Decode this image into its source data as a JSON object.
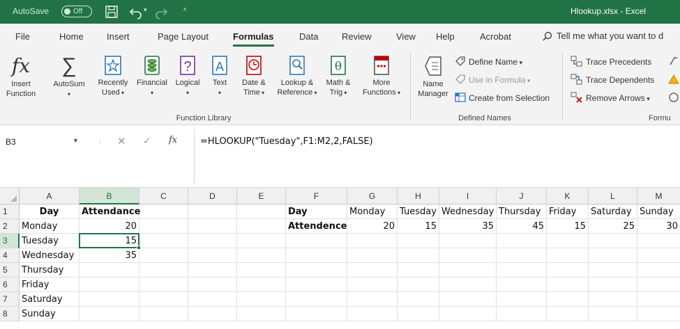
{
  "titlebar": {
    "autosave_label": "AutoSave",
    "autosave_state": "Off",
    "document_title": "Hlookup.xlsx  -  Excel"
  },
  "tabs": [
    {
      "label": "File"
    },
    {
      "label": "Home"
    },
    {
      "label": "Insert"
    },
    {
      "label": "Page Layout"
    },
    {
      "label": "Formulas"
    },
    {
      "label": "Data"
    },
    {
      "label": "Review"
    },
    {
      "label": "View"
    },
    {
      "label": "Help"
    },
    {
      "label": "Acrobat"
    }
  ],
  "tell_me": "Tell me what you want to d",
  "ribbon": {
    "insert_function": [
      "Insert",
      "Function"
    ],
    "autosum": "AutoSum",
    "recently_used": [
      "Recently",
      "Used"
    ],
    "financial": "Financial",
    "logical": "Logical",
    "text": "Text",
    "date_time": [
      "Date &",
      "Time"
    ],
    "lookup": [
      "Lookup &",
      "Reference"
    ],
    "math": [
      "Math &",
      "Trig"
    ],
    "more": [
      "More",
      "Functions"
    ],
    "function_library_label": "Function Library",
    "name_manager": [
      "Name",
      "Manager"
    ],
    "define_name": "Define Name",
    "use_in_formula": "Use in Formula",
    "create_from_selection": "Create from Selection",
    "defined_names_label": "Defined Names",
    "trace_precedents": "Trace Precedents",
    "trace_dependents": "Trace Dependents",
    "remove_arrows": "Remove Arrows",
    "formula_auditing_label": "Formu"
  },
  "formula_bar": {
    "name_box": "B3",
    "formula": "=HLOOKUP(\"Tuesday\",F1:M2,2,FALSE)"
  },
  "grid": {
    "columns": [
      "A",
      "B",
      "C",
      "D",
      "E",
      "F",
      "G",
      "H",
      "I",
      "J",
      "K",
      "L",
      "M"
    ],
    "rows": [
      "1",
      "2",
      "3",
      "4",
      "5",
      "6",
      "7",
      "8"
    ],
    "cells": {
      "A1": "Day",
      "B1": "Attendance",
      "A2": "Monday",
      "B2": "20",
      "A3": "Tuesday",
      "B3": "15",
      "A4": "Wednesday",
      "B4": "35",
      "A5": "Thursday",
      "A6": "Friday",
      "A7": "Saturday",
      "A8": "Sunday",
      "F1": "Day",
      "G1": "Monday",
      "H1": "Tuesday",
      "I1": "Wednesday",
      "J1": "Thursday",
      "K1": "Friday",
      "L1": "Saturday",
      "M1": "Sunday",
      "F2": "Attendence",
      "G2": "20",
      "H2": "15",
      "I2": "35",
      "J2": "45",
      "K2": "15",
      "L2": "25",
      "M2": "30"
    },
    "active_cell": "B3"
  }
}
